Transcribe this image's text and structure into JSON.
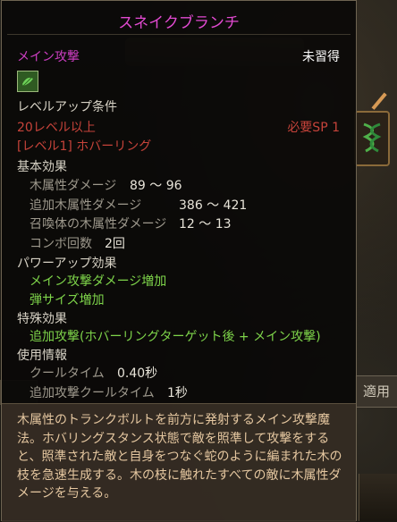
{
  "skill": {
    "name": "スネイクブランチ",
    "category": "メイン攻撃",
    "status": "未習得",
    "icon": "snake-branch-skill-icon"
  },
  "levelup": {
    "heading": "レベルアップ条件",
    "level_req": "20レベル以上",
    "sp_req": "必要SP 1",
    "prereq": "[レベル1] ホバーリング"
  },
  "basic": {
    "heading": "基本効果",
    "stats": [
      {
        "label": "木属性ダメージ",
        "value": "89 ～ 96"
      },
      {
        "label": "追加木属性ダメージ",
        "value": "386 ～ 421"
      },
      {
        "label": "召喚体の木属性ダメージ",
        "value": "12 ～ 13"
      },
      {
        "label": "コンボ回数",
        "value": "2回"
      }
    ]
  },
  "powerup": {
    "heading": "パワーアップ効果",
    "items": [
      "メイン攻撃ダメージ増加",
      "弾サイズ増加"
    ]
  },
  "special": {
    "heading": "特殊効果",
    "items": [
      "追加攻撃(ホバーリングターゲット後 + メイン攻撃)"
    ]
  },
  "usage": {
    "heading": "使用情報",
    "stats": [
      {
        "label": "クールタイム",
        "value": "0.40秒"
      },
      {
        "label": "追加攻撃クールタイム",
        "value": "1秒"
      }
    ]
  },
  "description": {
    "lines": [
      "木属性のトランクボルトを前方に発射するメイン攻撃魔",
      "法。ホバリングスタンス状態で敵を照準して攻撃をすると、照準された敵と自身をつなぐ蛇のように編まれた木の枝を急速生成する。木の枝に触れたすべての敵に木属性ダメージを与える。"
    ]
  },
  "background": {
    "tab_label": "適用"
  },
  "colors": {
    "title": "#e24ad1",
    "requirement": "#c6433a",
    "effect": "#7ed44a",
    "description": "#e5c7a0"
  }
}
